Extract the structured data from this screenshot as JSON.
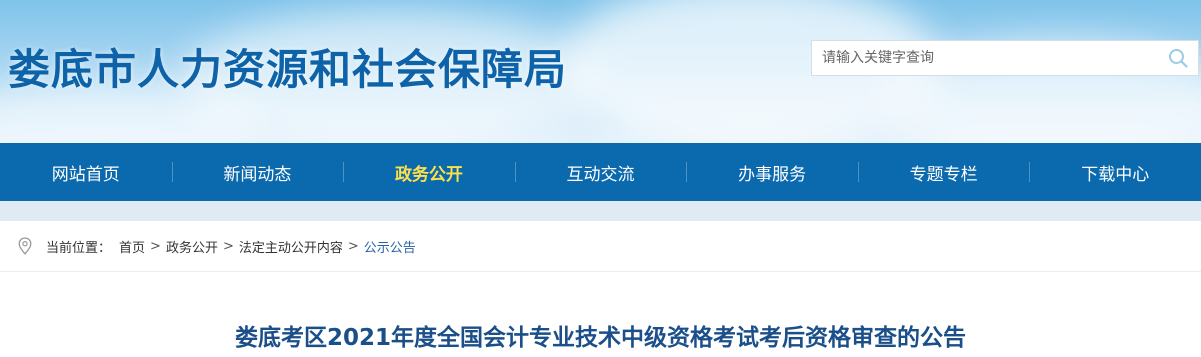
{
  "header": {
    "site_title": "娄底市人力资源和社会保障局",
    "search_placeholder": "请输入关键字查询"
  },
  "nav": {
    "items": [
      {
        "label": "网站首页"
      },
      {
        "label": "新闻动态"
      },
      {
        "label": "政务公开",
        "active": true
      },
      {
        "label": "互动交流"
      },
      {
        "label": "办事服务"
      },
      {
        "label": "专题专栏"
      },
      {
        "label": "下载中心"
      }
    ]
  },
  "breadcrumb": {
    "prefix": "当前位置：",
    "items": [
      "首页",
      "政务公开",
      "法定主动公开内容",
      "公示公告"
    ],
    "separator": ">"
  },
  "article": {
    "title": "娄底考区2021年度全国会计专业技术中级资格考试考后资格审查的公告"
  },
  "colors": {
    "nav_bg": "#0b69ad",
    "nav_active": "#ffe14a",
    "title_blue": "#0e62a8",
    "article_title": "#1b4f8a"
  },
  "icons": {
    "search": "search-icon",
    "location": "location-pin-icon"
  }
}
